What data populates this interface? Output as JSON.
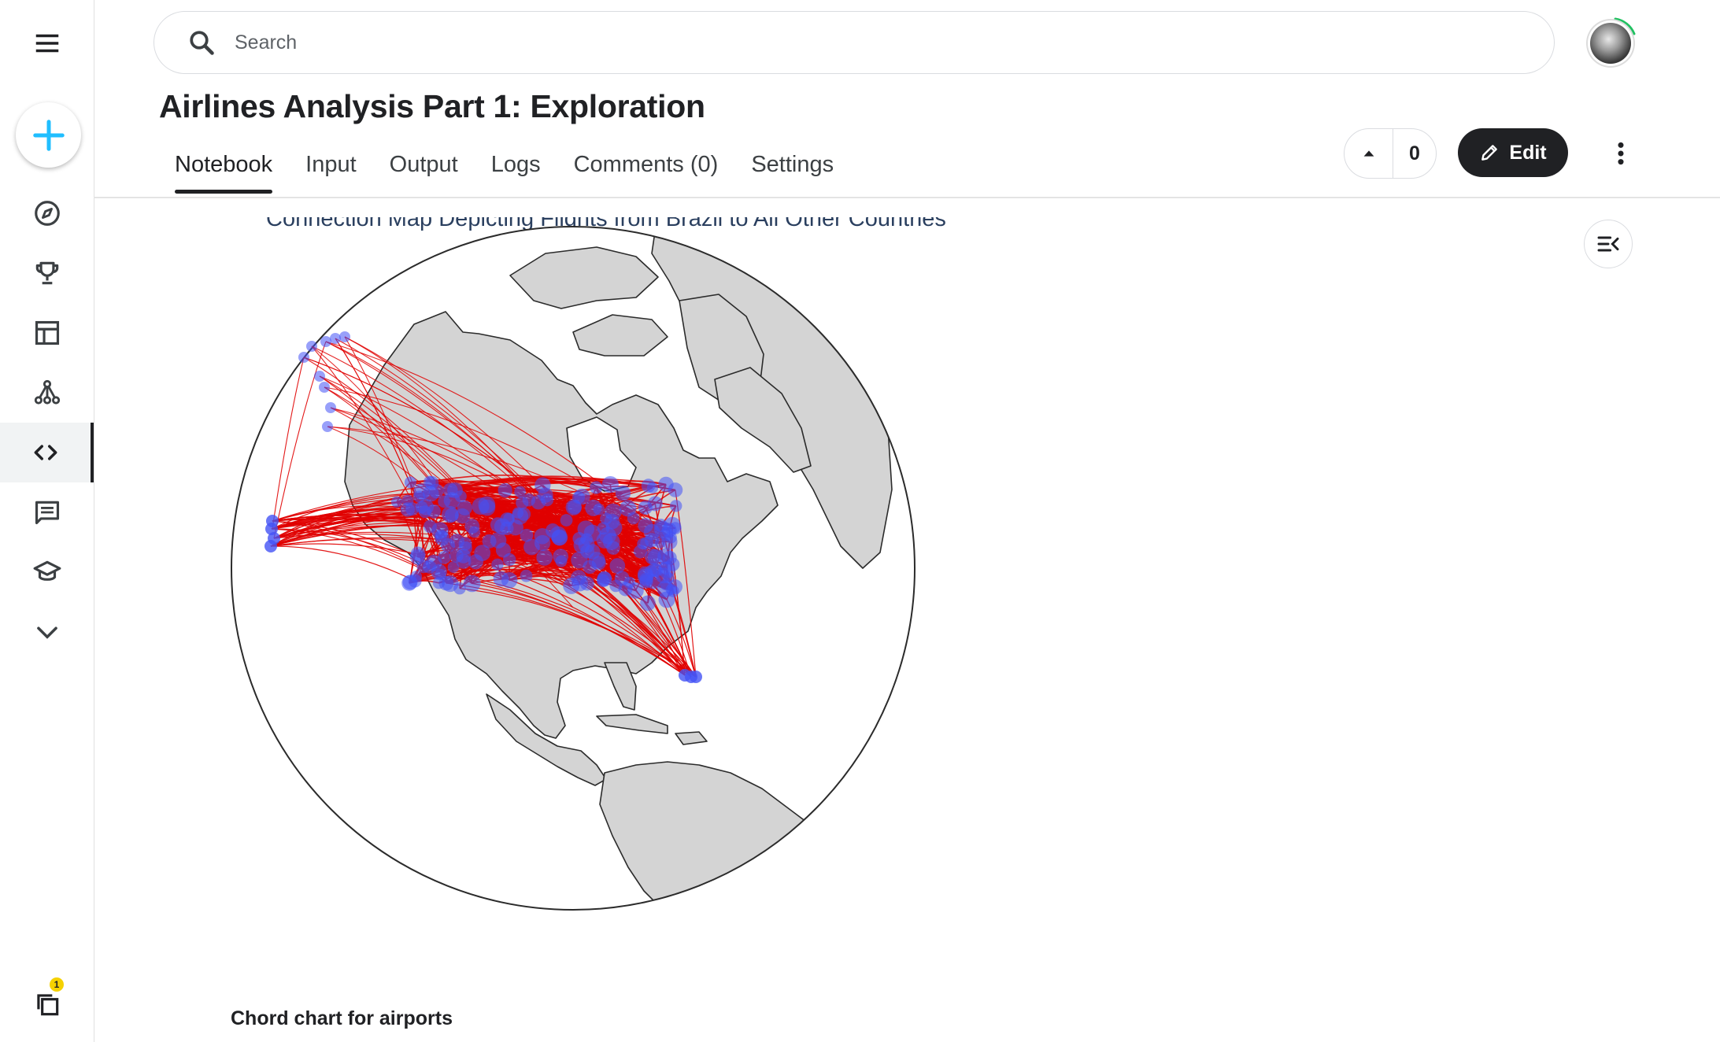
{
  "sidebar": {
    "items": [
      {
        "icon": "menu-icon"
      },
      {
        "icon": "plus-icon",
        "label": "Create"
      },
      {
        "icon": "compass-icon",
        "label": "Explore"
      },
      {
        "icon": "trophy-icon",
        "label": "Competitions"
      },
      {
        "icon": "table-icon",
        "label": "Datasets"
      },
      {
        "icon": "model-icon",
        "label": "Models"
      },
      {
        "icon": "code-icon",
        "label": "Code",
        "active": true
      },
      {
        "icon": "comment-icon",
        "label": "Discussions"
      },
      {
        "icon": "school-icon",
        "label": "Learn"
      },
      {
        "icon": "chevron-down-icon",
        "label": "More"
      }
    ],
    "notifications_badge": "1"
  },
  "search": {
    "placeholder": "Search",
    "value": ""
  },
  "notebook": {
    "title": "Airlines Analysis Part 1: Exploration",
    "tabs": [
      "Notebook",
      "Input",
      "Output",
      "Logs",
      "Comments (0)",
      "Settings"
    ],
    "active_tab": "Notebook",
    "vote_count": "0",
    "edit_label": "Edit"
  },
  "content": {
    "map_title": "Connection Map Depicting Flights from Brazil to All Other Countries",
    "section_heading": "Chord chart for airports"
  },
  "colors": {
    "route": "#e00000",
    "airport": "#4452f5",
    "land": "#d4d4d4",
    "accent": "#20beff"
  }
}
